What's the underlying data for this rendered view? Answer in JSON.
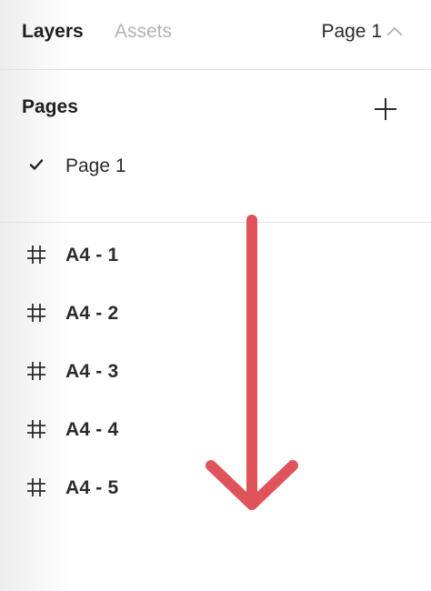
{
  "header": {
    "tabs": [
      {
        "label": "Layers",
        "active": true
      },
      {
        "label": "Assets",
        "active": false
      }
    ],
    "page_selector": {
      "label": "Page 1",
      "icon": "chevron-up-icon"
    }
  },
  "pages": {
    "title": "Pages",
    "add_icon": "plus-icon",
    "items": [
      {
        "label": "Page 1",
        "selected": true,
        "icon": "checkmark-icon"
      }
    ]
  },
  "layers": {
    "items": [
      {
        "label": "A4 - 1",
        "icon": "frame-icon"
      },
      {
        "label": "A4 - 2",
        "icon": "frame-icon"
      },
      {
        "label": "A4 - 3",
        "icon": "frame-icon"
      },
      {
        "label": "A4 - 4",
        "icon": "frame-icon"
      },
      {
        "label": "A4 - 5",
        "icon": "frame-icon"
      }
    ]
  },
  "annotation": {
    "icon": "down-arrow-icon",
    "color": "#e0535a"
  }
}
